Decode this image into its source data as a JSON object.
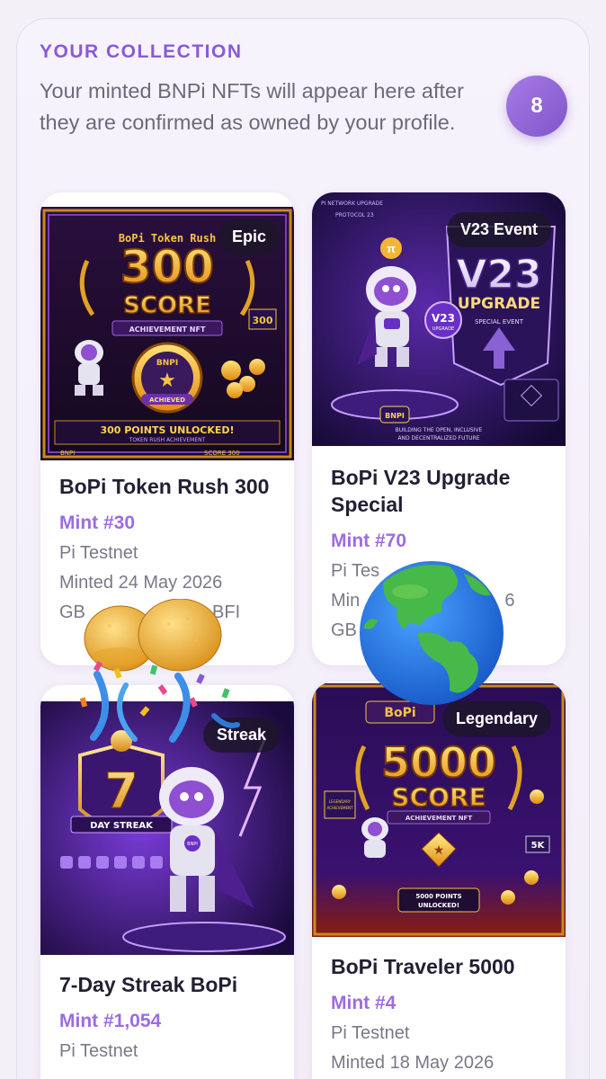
{
  "collection": {
    "title": "YOUR COLLECTION",
    "description": "Your minted BNPi NFTs will appear here after they are confirmed as owned by your profile.",
    "count": "8"
  },
  "cards": [
    {
      "title": "BoPi Token Rush 300",
      "tag": "Epic",
      "mint": "Mint #30",
      "network": "Pi Testnet",
      "date": "Minted 24 May 2026",
      "address": "GB",
      "address_tail": "BFI",
      "art": {
        "brand": "BoPi  Token Rush",
        "score": "300",
        "score_word": "SCORE",
        "sub": "ACHIEVEMENT NFT",
        "coin": "BNPI",
        "coin_sub": "ACHIEVED",
        "side": "300",
        "banner": "300 POINTS UNLOCKED!",
        "banner_sub": "TOKEN RUSH ACHIEVEMENT",
        "footer_left": "BNPI",
        "footer_right": "SCORE  300"
      }
    },
    {
      "title": "BoPi V23 Upgrade Special",
      "tag": "V23 Event",
      "mint": "Mint #70",
      "network": "Pi Tes",
      "date": "Min",
      "date_tail": "6",
      "address": "GB",
      "art": {
        "top1": "PI NETWORK UPGRADE",
        "top2": "PROTOCOL 23",
        "big": "V23",
        "word": "UPGRADE",
        "sub": "SPECIAL EVENT",
        "coin": "V23",
        "coin_sub": "UPGRADE",
        "chest": "BNPI",
        "footer1": "BUILDING THE OPEN, INCLUSIVE",
        "footer2": "AND DECENTRALIZED FUTURE"
      }
    },
    {
      "title": "7-Day Streak BoPi",
      "tag": "Streak",
      "mint": "Mint #1,054",
      "network": "Pi Testnet",
      "art": {
        "num": "7",
        "label": "DAY STREAK",
        "chest": "BNPI"
      }
    },
    {
      "title": "BoPi Traveler 5000",
      "tag": "Legendary",
      "mint": "Mint #4",
      "network": "Pi Testnet",
      "date": "Minted 18 May 2026",
      "art": {
        "brand": "BoPi",
        "score": "5000",
        "score_word": "SCORE",
        "sub": "ACHIEVEMENT NFT",
        "flag": "5K",
        "banner": "5000 POINTS",
        "banner2": "UNLOCKED!",
        "left_badge1": "LEGENDARY",
        "left_badge2": "ACHIEVEMENT"
      }
    }
  ],
  "overlays": [
    "party-popper-emoji",
    "globe-americas-emoji"
  ],
  "colors": {
    "accent": "#8a5ad6",
    "badge": "#9466dc",
    "title": "#231f33",
    "muted": "#7a7888"
  }
}
